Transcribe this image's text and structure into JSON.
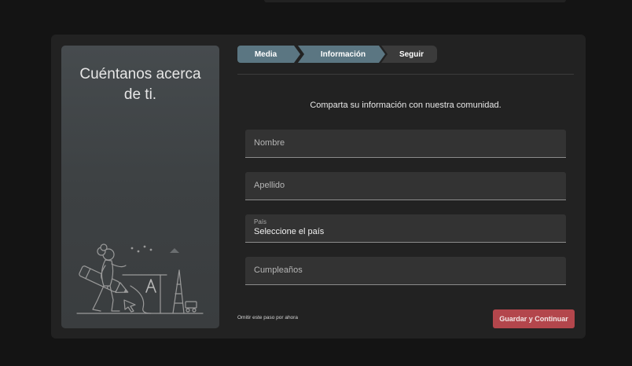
{
  "sidebar": {
    "title": "Cuéntanos acerca de ti."
  },
  "stepper": {
    "steps": [
      {
        "label": "Media"
      },
      {
        "label": "Información"
      },
      {
        "label": "Seguir"
      }
    ],
    "active_index": 1
  },
  "form": {
    "subtitle": "Comparta su información con nuestra comunidad.",
    "first_name": {
      "placeholder": "Nombre",
      "value": ""
    },
    "last_name": {
      "placeholder": "Apellido",
      "value": ""
    },
    "country": {
      "label": "País",
      "value": "Seleccione el país"
    },
    "birthday": {
      "placeholder": "Cumpleaños",
      "value": ""
    }
  },
  "footer": {
    "skip_label": "Omitir este paso por ahora",
    "save_label": "Guardar y Continuar"
  },
  "colors": {
    "step_active": "#5b7682",
    "step_inactive": "#3b3b3b",
    "primary_button": "#b3464c"
  }
}
